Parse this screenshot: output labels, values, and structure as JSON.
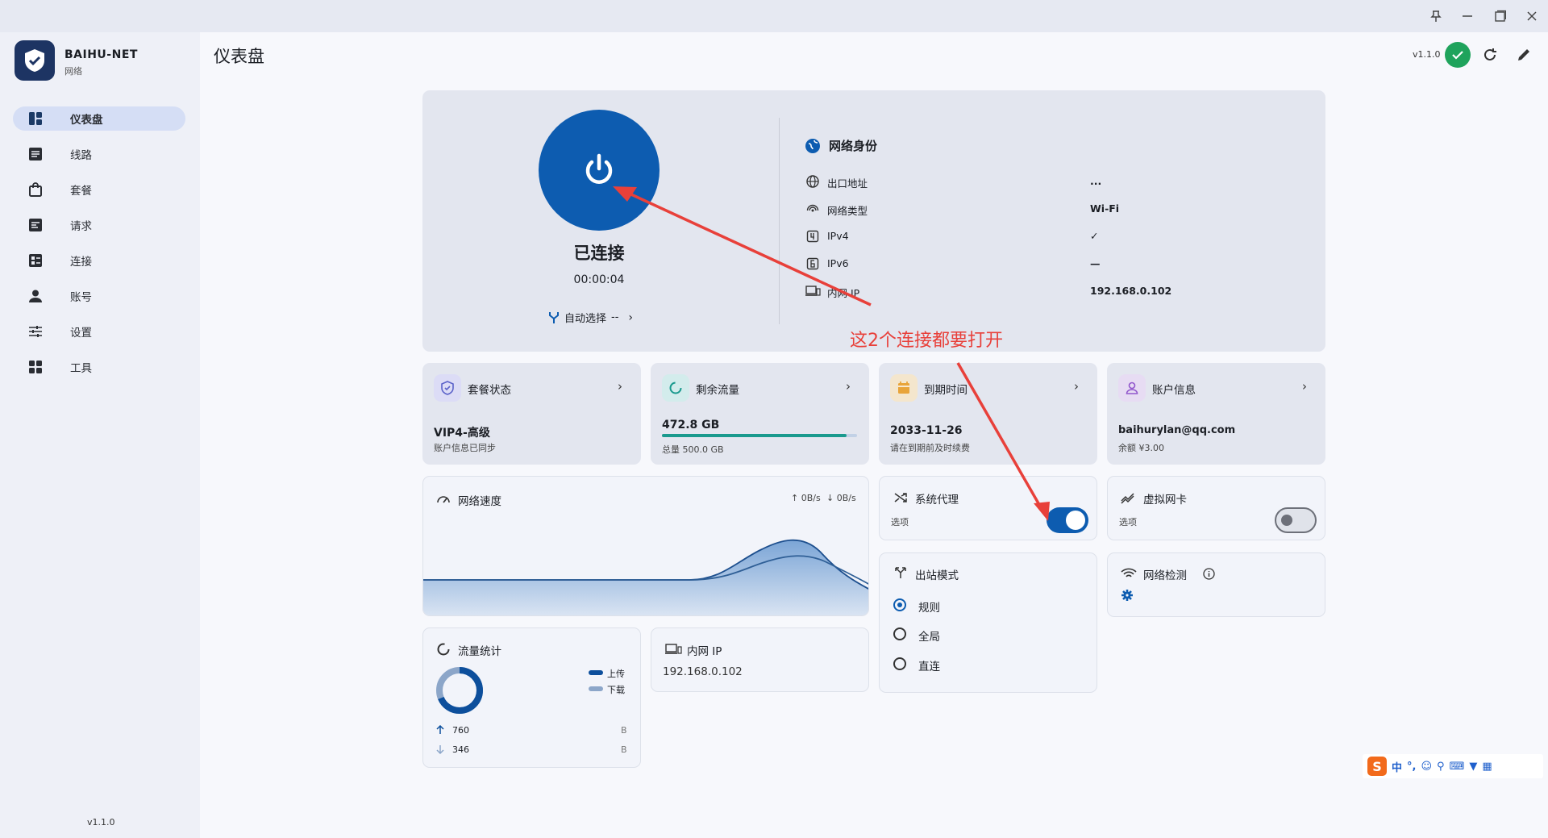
{
  "window": {
    "pin_icon": "pin-icon",
    "minimize_icon": "minimize-icon",
    "maximize_icon": "maximize-icon",
    "close_icon": "close-icon"
  },
  "app": {
    "brand": "BAIHU-NET",
    "brand_sub": "网络",
    "version": "v1.1.0"
  },
  "sidebar": {
    "items": [
      {
        "label": "仪表盘",
        "icon": "dashboard-icon",
        "active": true
      },
      {
        "label": "线路",
        "icon": "list-icon"
      },
      {
        "label": "套餐",
        "icon": "bag-icon"
      },
      {
        "label": "请求",
        "icon": "request-icon"
      },
      {
        "label": "连接",
        "icon": "connection-icon"
      },
      {
        "label": "账号",
        "icon": "person-icon"
      },
      {
        "label": "设置",
        "icon": "sliders-icon"
      },
      {
        "label": "工具",
        "icon": "grid-icon"
      }
    ]
  },
  "header": {
    "title": "仪表盘",
    "version": "v1.1.0"
  },
  "connection": {
    "status": "已连接",
    "timer": "00:00:04",
    "auto_select": "自动选择",
    "auto_select_value": "--"
  },
  "identity": {
    "title": "网络身份",
    "rows": [
      {
        "label": "出口地址",
        "value": "..."
      },
      {
        "label": "网络类型",
        "value": "Wi-Fi"
      },
      {
        "label": "IPv4",
        "value": "✓"
      },
      {
        "label": "IPv6",
        "value": "—"
      },
      {
        "label": "内网 IP",
        "value": "192.168.0.102"
      }
    ]
  },
  "annotation": {
    "text": "这2个连接都要打开"
  },
  "stats": [
    {
      "title": "套餐状态",
      "value": "VIP4-高级",
      "sub": "账户信息已同步",
      "badge_color": "#dcdcf6"
    },
    {
      "title": "剩余流量",
      "value": "472.8 GB",
      "sub": "总量 500.0 GB",
      "progress": 0.946,
      "badge_color": "#d3ecec"
    },
    {
      "title": "到期时间",
      "value": "2033-11-26",
      "sub": "请在到期前及时续费",
      "badge_color": "#f4e6cd"
    },
    {
      "title": "账户信息",
      "value": "baihurylan@qq.com",
      "sub": "余额 ¥3.00",
      "badge_color": "#e7dcf3"
    }
  ],
  "speed": {
    "title": "网络速度",
    "up": "↑ 0B/s",
    "down": "↓ 0B/s"
  },
  "proxy": {
    "title": "系统代理",
    "sub": "选项",
    "on": true
  },
  "tun": {
    "title": "虚拟网卡",
    "sub": "选项",
    "on": false
  },
  "outbound": {
    "title": "出站模式",
    "options": [
      {
        "label": "规则",
        "selected": true
      },
      {
        "label": "全局",
        "selected": false
      },
      {
        "label": "直连",
        "selected": false
      }
    ]
  },
  "netcheck": {
    "title": "网络检测"
  },
  "traffic": {
    "title": "流量统计",
    "legend_up": "上传",
    "legend_down": "下载",
    "up": "760",
    "down": "346",
    "unit": "B"
  },
  "lanip": {
    "title": "内网 IP",
    "value": "192.168.0.102"
  }
}
